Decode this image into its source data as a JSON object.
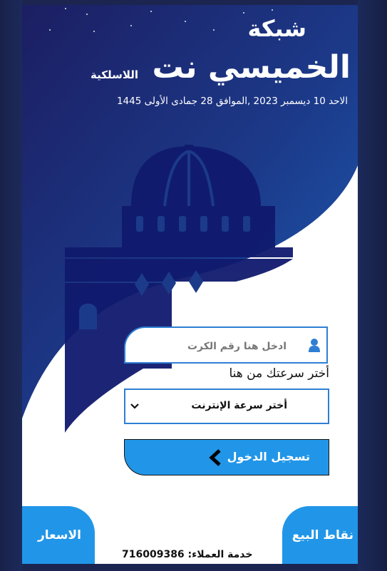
{
  "brand": {
    "line1": "شبكة",
    "line2": "الخميسي نت",
    "line3": "اللاسلكية"
  },
  "date_line": "الاحد 10 ديسمبر 2023 ,الموافق 28 جمادى الأولى 1445",
  "form": {
    "card_placeholder": "ادخل هنا رقم الكرت",
    "speed_label": "أختر سرعتك من هنا",
    "speed_select_value": "أختر سرعة الإنترنت",
    "login_label": "تسجيل الدخول"
  },
  "footer": {
    "prices_label": "الاسعار",
    "sales_points_label": "نقاط البيع",
    "support_label": "خدمة العملاء:",
    "support_phone": "716009386"
  },
  "colors": {
    "primary_blue": "#2196e8",
    "hero_dark": "#1c2066",
    "hero_blue": "#1e4fa3"
  },
  "icons": [
    "crescent-moon-icon",
    "mosque-dome-illustration",
    "user-icon",
    "chevron-down-icon",
    "chevron-left-icon"
  ]
}
